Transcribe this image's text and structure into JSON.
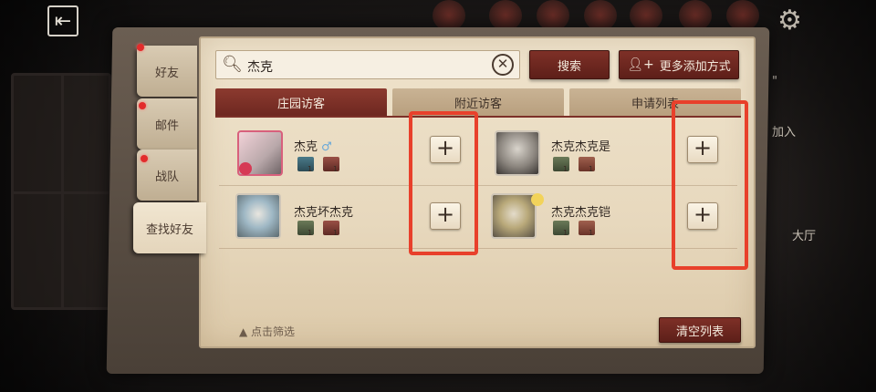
{
  "tabs_side": [
    {
      "label": "好友",
      "dot": true
    },
    {
      "label": "邮件",
      "dot": true
    },
    {
      "label": "战队",
      "dot": true
    },
    {
      "label": "查找好友",
      "dot": false
    }
  ],
  "search": {
    "value": "杰克"
  },
  "buttons": {
    "search": "搜索",
    "more_add": "更多添加方式",
    "clear_list": "清空列表"
  },
  "tabs": [
    "庄园访客",
    "附近访客",
    "申请列表"
  ],
  "results": [
    {
      "name": "杰克",
      "gender": "♂",
      "add": "+"
    },
    {
      "name": "杰克杰克是",
      "gender": "",
      "add": "+"
    },
    {
      "name": "杰克坏杰克",
      "gender": "",
      "add": "+"
    },
    {
      "name": "杰克杰克铠",
      "gender": "",
      "add": "+"
    }
  ],
  "badge_sub": "1",
  "filter_label": "点击筛选",
  "right_hints": [
    "\"",
    "加入",
    "大厅"
  ],
  "colors": {
    "accent_dark_red": "#6e2720",
    "highlight_red": "#e8402b",
    "paper": "#efe3cc"
  },
  "icons": [
    "exit-door-icon",
    "gear-icon",
    "search-icon",
    "clear-icon",
    "add-friend-icon",
    "triangle-up-icon"
  ]
}
